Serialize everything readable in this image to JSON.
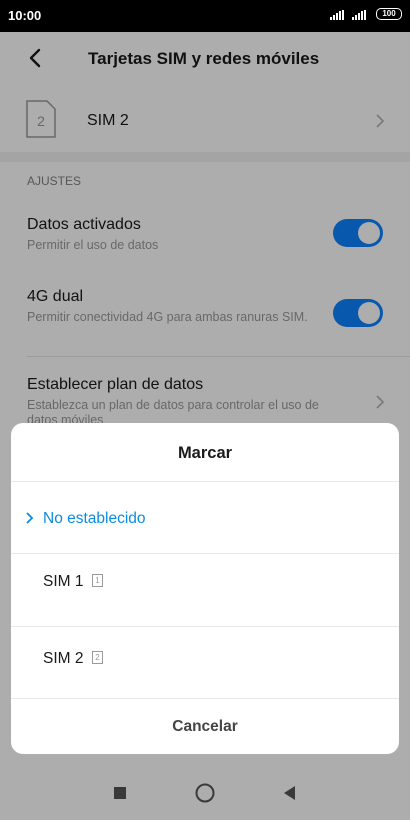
{
  "status": {
    "time": "10:00",
    "battery": "100"
  },
  "header": {
    "title": "Tarjetas SIM y redes móviles"
  },
  "sim_row": {
    "label": "SIM 2",
    "icon_number": "2"
  },
  "section": {
    "title": "AJUSTES"
  },
  "settings": [
    {
      "title": "Datos activados",
      "subtitle": "Permitir el uso de datos",
      "toggle": true
    },
    {
      "title": "4G dual",
      "subtitle": "Permitir conectividad 4G para ambas ranuras SIM.",
      "toggle": true
    },
    {
      "title": "Establecer plan de datos",
      "subtitle": "Establezca un plan de datos para controlar el uso de datos móviles"
    }
  ],
  "dialog": {
    "title": "Marcar",
    "options": [
      {
        "label": "No establecido",
        "selected": true
      },
      {
        "label": "SIM 1",
        "badge": "1"
      },
      {
        "label": "SIM 2",
        "badge": "2"
      }
    ],
    "cancel_label": "Cancelar"
  },
  "colors": {
    "accent": "#0d84ff",
    "selected_text": "#0a8de0",
    "overlay": "rgba(0,0,0,0.32)"
  },
  "icons": {
    "back": "back-arrow-icon",
    "chevron": "chevron-right-icon",
    "nav": [
      "square-icon",
      "circle-icon",
      "triangle-back-icon"
    ]
  }
}
